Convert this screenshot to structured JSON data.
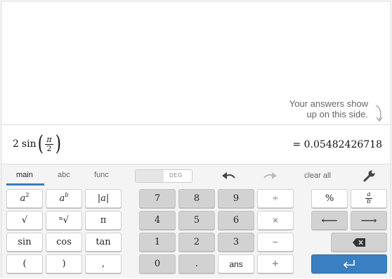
{
  "history": {
    "hint_line1": "Your answers show",
    "hint_line2": "up on this side."
  },
  "expression": {
    "coefficient": "2",
    "function": "sin",
    "numerator": "π",
    "denominator": "2",
    "result": "= 0.05482426718"
  },
  "tabs": {
    "main": "main",
    "abc": "abc",
    "func": "func",
    "active": "main"
  },
  "angle_toggle": {
    "off_label": "DEG"
  },
  "controls": {
    "undo_icon": "undo-icon",
    "redo_icon": "redo-icon",
    "clear_all": "clear all",
    "settings_icon": "wrench-icon"
  },
  "keys": {
    "a_squared_base": "a",
    "a_squared_exp": "2",
    "a_power_base": "a",
    "a_power_exp": "b",
    "abs": "|a|",
    "sqrt": "√",
    "nthroot": "ⁿ√",
    "pi": "π",
    "sin": "sin",
    "cos": "cos",
    "tan": "tan",
    "lparen": "(",
    "rparen": ")",
    "comma": ",",
    "seven": "7",
    "eight": "8",
    "nine": "9",
    "divide": "÷",
    "four": "4",
    "five": "5",
    "six": "6",
    "times": "×",
    "one": "1",
    "two": "2",
    "three": "3",
    "minus": "−",
    "zero": "0",
    "point": ".",
    "ans": "ans",
    "plus": "+",
    "percent": "%",
    "frac_num": "a",
    "frac_den": "b",
    "left_arrow": "⟵",
    "right_arrow": "⟶",
    "backspace_icon": "backspace-icon",
    "enter_icon": "enter-icon"
  },
  "colors": {
    "accent": "#3a7fc1",
    "number_key": "#d2d2d2",
    "keypad_bg": "#f4f4f4"
  }
}
